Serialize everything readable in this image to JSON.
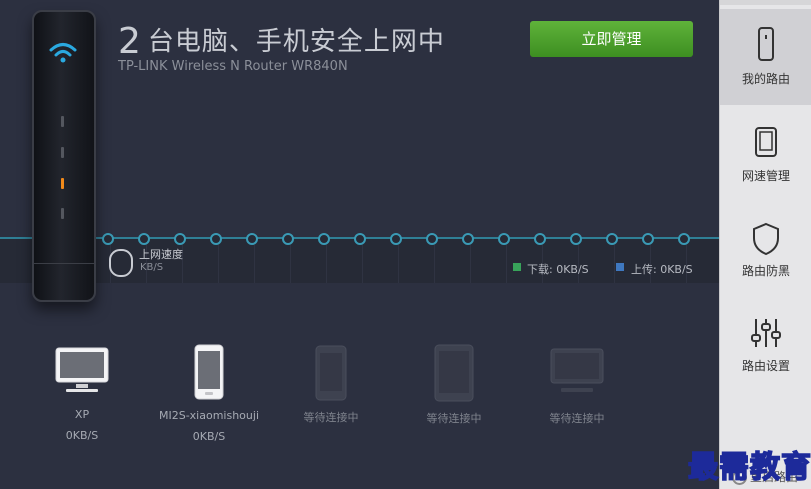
{
  "header": {
    "count": "2",
    "status_text": "台电脑、手机安全上网中",
    "router_model": "TP-LINK Wireless N Router WR840N",
    "manage_label": "立即管理"
  },
  "speed": {
    "label": "上网速度",
    "value": "KB/S",
    "download_label": "下载: 0KB/S",
    "upload_label": "上传: 0KB/S"
  },
  "devices": [
    {
      "name": "XP",
      "speed": "0KB/S",
      "icon": "laptop-icon"
    },
    {
      "name": "MI2S-xiaomishouji",
      "speed": "0KB/S",
      "icon": "phone-icon"
    },
    {
      "name": "等待连接中",
      "icon": "phone-icon"
    },
    {
      "name": "等待连接中",
      "icon": "tablet-icon"
    },
    {
      "name": "等待连接中",
      "icon": "laptop-icon"
    }
  ],
  "sidebar": {
    "items": [
      {
        "label": "我的路由",
        "icon": "router-icon",
        "active": true
      },
      {
        "label": "网速管理",
        "icon": "tablet-icon",
        "active": false
      },
      {
        "label": "路由防黑",
        "icon": "shield-icon",
        "active": false
      },
      {
        "label": "路由设置",
        "icon": "sliders-icon",
        "active": false
      }
    ],
    "restart_label": "重启路由"
  },
  "watermark": "最需教育",
  "colors": {
    "background": "#2c3040",
    "accent_green": "#4ea62c",
    "download": "#38a35a",
    "upload": "#3f78c0",
    "wifi": "#2aa9e0",
    "line": "#2f7f96"
  }
}
